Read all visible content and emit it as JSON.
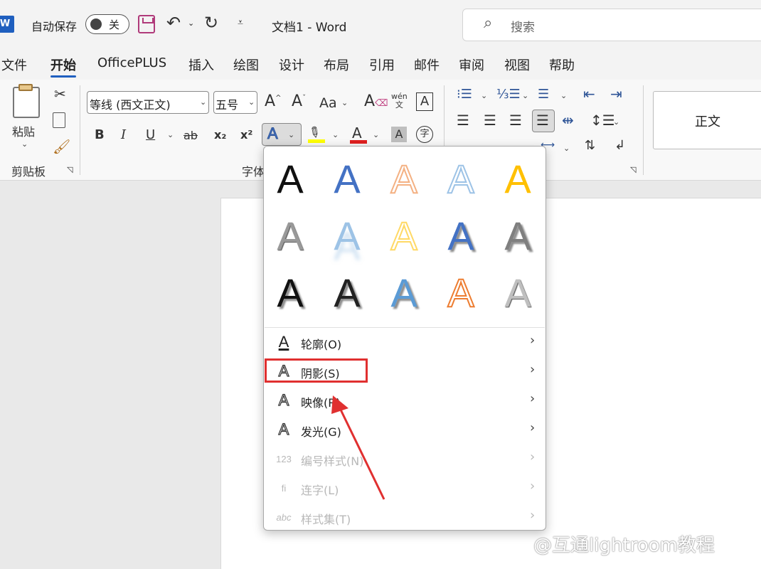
{
  "titlebar": {
    "app_icon": "word-logo",
    "logo_text": "W",
    "autosave_label": "自动保存",
    "autosave_state": "关",
    "doc_title": "文档1  -  Word",
    "search_placeholder": "搜索"
  },
  "tabs": [
    "文件",
    "开始",
    "OfficePLUS",
    "插入",
    "绘图",
    "设计",
    "布局",
    "引用",
    "邮件",
    "审阅",
    "视图",
    "帮助"
  ],
  "active_tab": "开始",
  "ribbon": {
    "clipboard": {
      "paste_label": "粘贴",
      "group_label": "剪贴板"
    },
    "font": {
      "font_name": "等线 (西文正文)",
      "font_size": "五号",
      "change_case": "Aa",
      "phonetic": "wén",
      "phonetic_char": "文",
      "group_label": "字体",
      "bold": "B",
      "italic": "I",
      "underline": "U",
      "strike": "ab",
      "sub": "x₂",
      "sup": "x²",
      "font_color_letter": "A",
      "shading_letter": "A",
      "enclose_char": "字"
    },
    "styles": {
      "normal": "正文"
    }
  },
  "dropdown": {
    "gallery": [
      {
        "style": "black-fill",
        "color": "#111111"
      },
      {
        "style": "blue-fill",
        "color": "#4472c4"
      },
      {
        "style": "orange-outline",
        "color": "#f4b183"
      },
      {
        "style": "blue-outline",
        "color": "#9dc3e6"
      },
      {
        "style": "gold-fill",
        "color": "#ffc000"
      },
      {
        "style": "gray-gradient",
        "color": "#999999"
      },
      {
        "style": "blue-reflection",
        "color": "#9dc3e6"
      },
      {
        "style": "gold-outline",
        "color": "#ffd966"
      },
      {
        "style": "blue-bevel",
        "color": "#4472c4"
      },
      {
        "style": "gray-shadow",
        "color": "#7f7f7f"
      },
      {
        "style": "black-shadow",
        "color": "#111111"
      },
      {
        "style": "dark-bevel",
        "color": "#222222"
      },
      {
        "style": "light-blue-shadow",
        "color": "#5b9bd5"
      },
      {
        "style": "orange-outline-2",
        "color": "#ed7d31"
      },
      {
        "style": "silver",
        "color": "#bfbfbf"
      }
    ],
    "gallery_letter": "A",
    "items": [
      {
        "label": "轮廓(O)",
        "icon": "A",
        "enabled": true
      },
      {
        "label": "阴影(S)",
        "icon": "A",
        "enabled": true
      },
      {
        "label": "映像(R)",
        "icon": "A",
        "enabled": true
      },
      {
        "label": "发光(G)",
        "icon": "A",
        "enabled": true
      },
      {
        "label": "编号样式(N)",
        "icon": "123",
        "enabled": false
      },
      {
        "label": "连字(L)",
        "icon": "fi",
        "enabled": false
      },
      {
        "label": "样式集(T)",
        "icon": "abc",
        "enabled": false
      }
    ],
    "arrow": "›"
  },
  "highlight_color": "#e03030",
  "watermark": "@互通lightroom教程"
}
